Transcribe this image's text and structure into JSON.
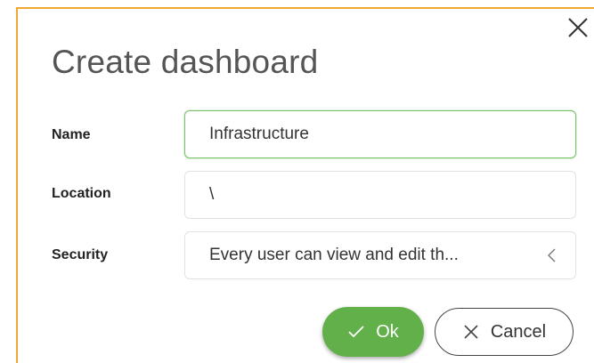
{
  "dialog": {
    "title": "Create dashboard",
    "close_icon": "close-icon",
    "accent_color": "#f0a830"
  },
  "form": {
    "name": {
      "label": "Name",
      "value": "Infrastructure"
    },
    "location": {
      "label": "Location",
      "value": "\\"
    },
    "security": {
      "label": "Security",
      "value": "Every user can view and edit th...",
      "chevron_icon": "chevron-left-icon"
    }
  },
  "actions": {
    "ok_label": "Ok",
    "ok_icon": "check-icon",
    "ok_color": "#62b04a",
    "cancel_label": "Cancel",
    "cancel_icon": "close-icon"
  }
}
